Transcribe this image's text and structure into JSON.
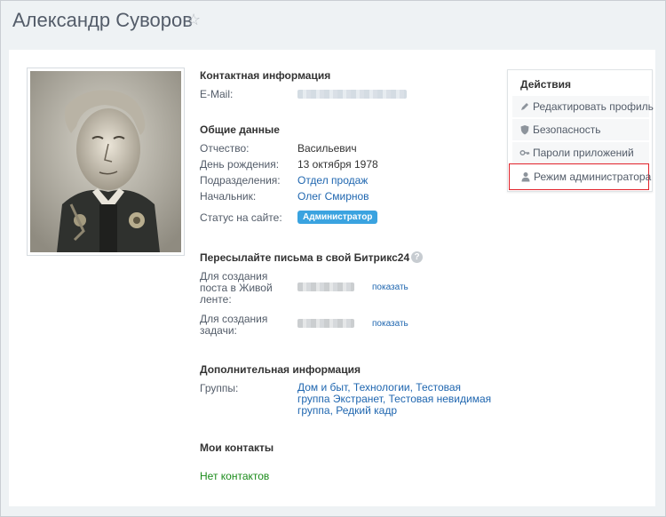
{
  "page": {
    "title": "Александр Суворов"
  },
  "icons": {
    "star": "star-icon"
  },
  "contact": {
    "title": "Контактная информация",
    "email_label": "E-Mail:"
  },
  "general": {
    "title": "Общие данные",
    "patronymic_label": "Отчество:",
    "patronymic_value": "Васильевич",
    "birthday_label": "День рождения:",
    "birthday_value": "13 октября 1978",
    "department_label": "Подразделения:",
    "department_value": "Отдел продаж",
    "manager_label": "Начальник:",
    "manager_value": "Олег Смирнов",
    "status_label": "Статус на сайте:",
    "status_value": "Администратор"
  },
  "forward": {
    "title": "Пересылайте письма в свой Битрикс24",
    "help_icon": "?",
    "post_label_1": "Для создания",
    "post_label_2": "поста в Живой",
    "post_label_3": "ленте:",
    "task_label_1": "Для создания",
    "task_label_2": "задачи:",
    "show_label": "показать"
  },
  "extra": {
    "title": "Дополнительная информация",
    "groups_label": "Группы:",
    "groups": [
      "Дом и быт",
      "Технологии",
      "Тестовая группа Экстранет",
      "Тестовая невидимая группа",
      "Редкий кадр"
    ]
  },
  "contacts": {
    "title": "Мои контакты",
    "empty": "Нет контактов"
  },
  "actions": {
    "title": "Действия",
    "items": [
      {
        "label": "Редактировать профиль",
        "icon": "pencil-icon"
      },
      {
        "label": "Безопасность",
        "icon": "shield-icon"
      },
      {
        "label": "Пароли приложений",
        "icon": "key-icon"
      },
      {
        "label": "Режим администратора",
        "icon": "user-icon"
      }
    ]
  },
  "colors": {
    "link": "#2067b0",
    "badge": "#3aa3e0",
    "highlight_border": "#e2232b",
    "empty_text": "#1a8b1a"
  }
}
